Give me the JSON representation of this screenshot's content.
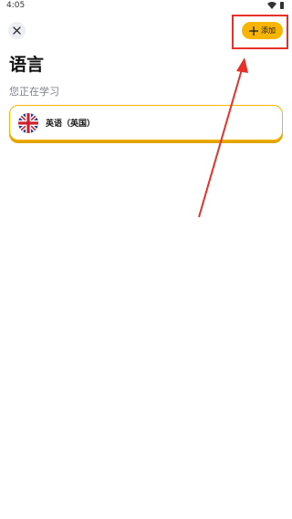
{
  "status_bar": {
    "time": "4:05",
    "icons": [
      "wifi-icon",
      "battery-icon"
    ]
  },
  "header": {
    "close_icon": "close-icon",
    "add_button_label": "添加",
    "add_icon": "plus-icon"
  },
  "page": {
    "title": "语言",
    "section_label": "您正在学习"
  },
  "languages": [
    {
      "name": "英语（英国）",
      "flag_icon": "uk-flag-icon",
      "selected": true
    }
  ],
  "colors": {
    "accent": "#f7b500",
    "annotation": "#e8302a"
  }
}
